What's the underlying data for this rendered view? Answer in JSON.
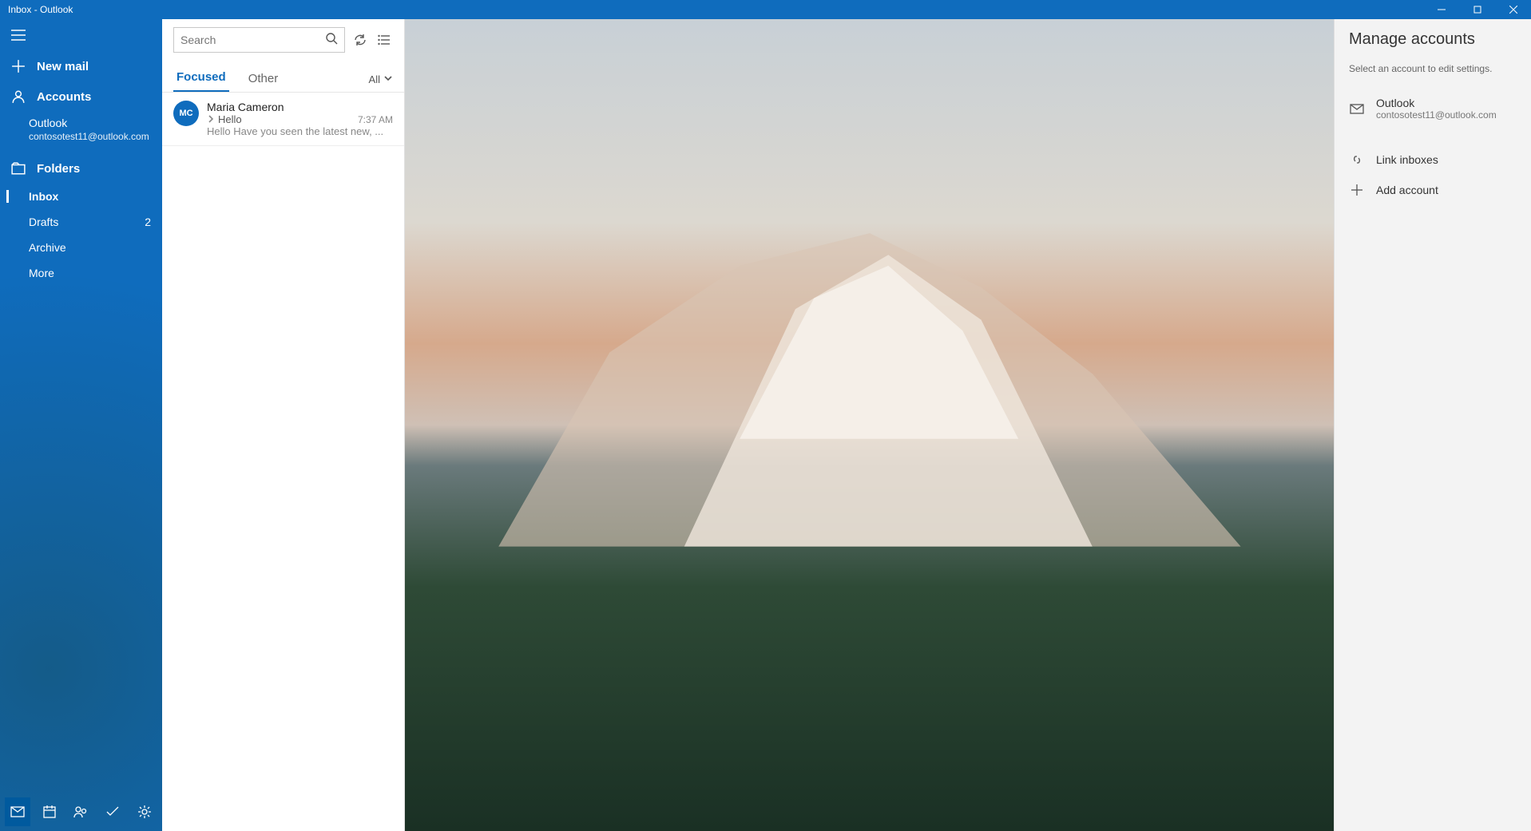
{
  "window": {
    "title": "Inbox - Outlook"
  },
  "sidebar": {
    "new_mail": "New mail",
    "accounts_header": "Accounts",
    "account": {
      "name": "Outlook",
      "email": "contosotest11@outlook.com"
    },
    "folders_header": "Folders",
    "folders": [
      {
        "name": "Inbox",
        "count": ""
      },
      {
        "name": "Drafts",
        "count": "2"
      },
      {
        "name": "Archive",
        "count": ""
      },
      {
        "name": "More",
        "count": ""
      }
    ]
  },
  "search": {
    "placeholder": "Search"
  },
  "tabs": {
    "focused": "Focused",
    "other": "Other",
    "filter": "All"
  },
  "emails": [
    {
      "initials": "MC",
      "sender": "Maria Cameron",
      "subject": "Hello",
      "time": "7:37 AM",
      "preview": "Hello Have you seen the latest new, ..."
    }
  ],
  "panel": {
    "title": "Manage accounts",
    "hint": "Select an account to edit settings.",
    "account": {
      "name": "Outlook",
      "email": "contosotest11@outlook.com"
    },
    "link_inboxes": "Link inboxes",
    "add_account": "Add account"
  }
}
